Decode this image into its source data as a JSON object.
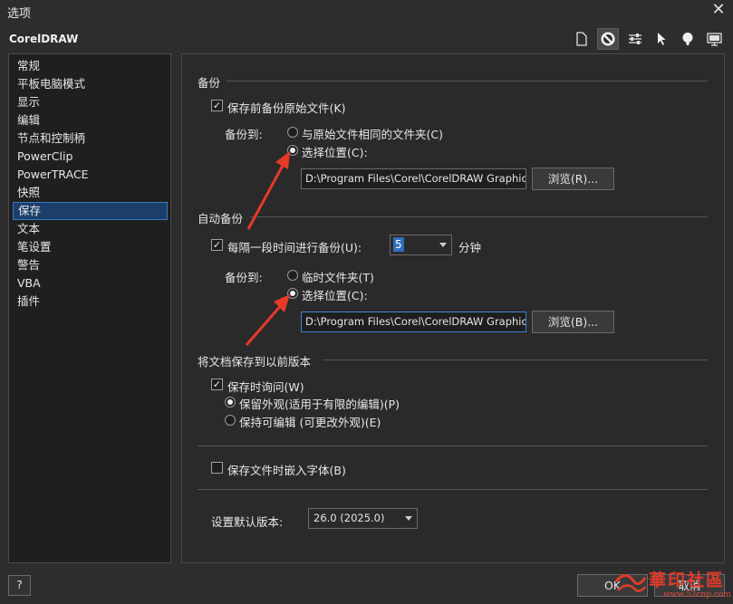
{
  "window": {
    "title": "选项",
    "close_glyph": "✕"
  },
  "app_name": "CorelDRAW",
  "toolbar_icons": [
    "page-icon",
    "settings-no-icon",
    "sliders-icon",
    "cursor-icon",
    "balloon-icon",
    "monitor-icon"
  ],
  "sidebar": {
    "items": [
      {
        "label": "常规"
      },
      {
        "label": "平板电脑模式"
      },
      {
        "label": "显示"
      },
      {
        "label": "编辑"
      },
      {
        "label": "节点和控制柄"
      },
      {
        "label": "PowerClip"
      },
      {
        "label": "PowerTRACE"
      },
      {
        "label": "快照"
      },
      {
        "label": "保存",
        "selected": true
      },
      {
        "label": "文本"
      },
      {
        "label": "笔设置"
      },
      {
        "label": "警告"
      },
      {
        "label": "VBA"
      },
      {
        "label": "插件"
      }
    ]
  },
  "backup": {
    "title": "备份",
    "checkbox_label": "保存前备份原始文件(K)",
    "checked": true,
    "backup_to_label": "备份到:",
    "radio_same_folder": "与原始文件相同的文件夹(C)",
    "radio_choose_location": "选择位置(C):",
    "selected": "choose",
    "path_value": "D:\\Program Files\\Corel\\CorelDRAW Graphics S",
    "browse_label": "浏览(R)..."
  },
  "autobackup": {
    "title": "自动备份",
    "checkbox_label": "每隔一段时间进行备份(U):",
    "checked": true,
    "interval_value": "5",
    "interval_unit": "分钟",
    "backup_to_label": "备份到:",
    "radio_temp_folder": "临时文件夹(T)",
    "radio_choose_location": "选择位置(C):",
    "selected": "choose",
    "path_value": "D:\\Program Files\\Corel\\CorelDRAW Graphics S",
    "browse_label": "浏览(B)..."
  },
  "save_old_version": {
    "title": "将文档保存到以前版本",
    "ask_on_save_label": "保存时询问(W)",
    "ask_on_save_checked": true,
    "radio_keep_appearance": "保留外观(适用于有限的编辑)(P)",
    "radio_keep_editable": "保持可编辑 (可更改外观)(E)",
    "selected": "appearance"
  },
  "embed_fonts": {
    "label": "保存文件时嵌入字体(B)",
    "checked": false
  },
  "default_version": {
    "label": "设置默认版本:",
    "value": "26.0 (2025.0)"
  },
  "footer": {
    "help_label": "?",
    "ok_label": "OK",
    "cancel_label": "取消"
  },
  "watermark": {
    "text": "華印社區",
    "url": "www.52cnp.com"
  },
  "colors": {
    "accent": "#3a86d6",
    "selection_bg": "#1b3f6a",
    "arrow_red": "#e53a2a"
  }
}
